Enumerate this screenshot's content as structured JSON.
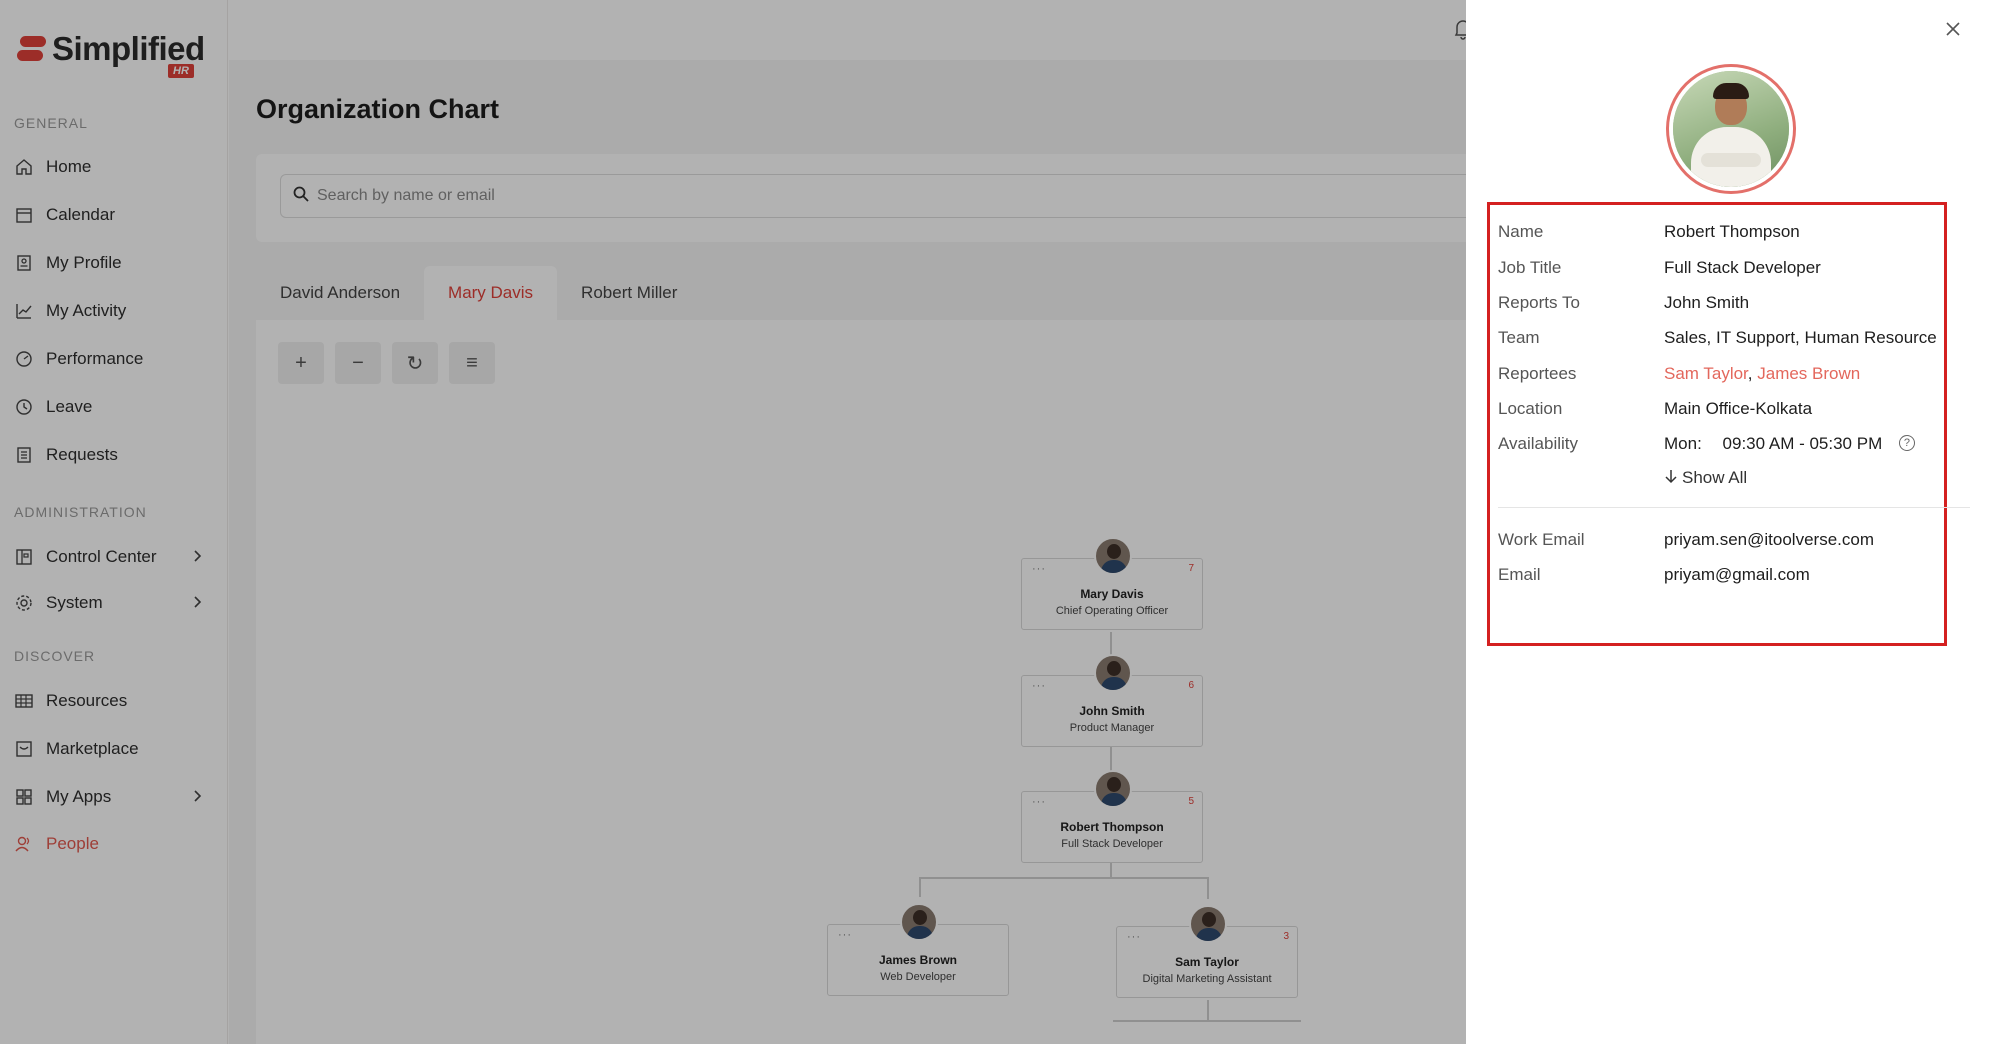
{
  "brand": {
    "name": "Simplified",
    "badge": "HR"
  },
  "sidebar": {
    "sections": [
      {
        "title": "GENERAL"
      },
      {
        "title": "ADMINISTRATION"
      },
      {
        "title": "DISCOVER"
      }
    ],
    "items": [
      {
        "label": "Home",
        "icon": "home-icon"
      },
      {
        "label": "Calendar",
        "icon": "calendar-icon"
      },
      {
        "label": "My Profile",
        "icon": "profile-icon"
      },
      {
        "label": "My Activity",
        "icon": "activity-icon"
      },
      {
        "label": "Performance",
        "icon": "performance-icon"
      },
      {
        "label": "Leave",
        "icon": "clock-icon"
      },
      {
        "label": "Requests",
        "icon": "requests-icon"
      },
      {
        "label": "Control Center",
        "icon": "control-center-icon"
      },
      {
        "label": "System",
        "icon": "gear-icon"
      },
      {
        "label": "Resources",
        "icon": "grid-table-icon"
      },
      {
        "label": "Marketplace",
        "icon": "marketplace-icon"
      },
      {
        "label": "My Apps",
        "icon": "apps-icon"
      },
      {
        "label": "People",
        "icon": "people-icon"
      }
    ],
    "active": "People",
    "accent": "#e35a4f"
  },
  "main": {
    "title": "Organization Chart",
    "search": {
      "placeholder": "Search by name or email",
      "value": ""
    },
    "tabs": [
      {
        "label": "David Anderson"
      },
      {
        "label": "Mary Davis"
      },
      {
        "label": "Robert Miller"
      }
    ],
    "active_tab": "Mary Davis",
    "tools": [
      "+",
      "−",
      "↻",
      "≡"
    ]
  },
  "org_chart": {
    "nodes": [
      {
        "name": "Mary Davis",
        "role": "Chief Operating Officer",
        "count": "7"
      },
      {
        "name": "John Smith",
        "role": "Product Manager",
        "count": "6"
      },
      {
        "name": "Robert Thompson",
        "role": "Full Stack Developer",
        "count": "5"
      },
      {
        "name": "James Brown",
        "role": "Web Developer",
        "count": ""
      },
      {
        "name": "Sam Taylor",
        "role": "Digital Marketing Assistant",
        "count": "3"
      }
    ],
    "dots": "···"
  },
  "drawer": {
    "fields": {
      "name": {
        "label": "Name",
        "value": "Robert Thompson"
      },
      "job_title": {
        "label": "Job Title",
        "value": "Full Stack Developer"
      },
      "reports_to": {
        "label": "Reports To",
        "value": "John Smith"
      },
      "team": {
        "label": "Team",
        "value": "Sales, IT Support, Human Resource"
      },
      "reportees": {
        "label": "Reportees",
        "values": [
          "Sam Taylor",
          "James Brown"
        ],
        "separator": ", "
      },
      "location": {
        "label": "Location",
        "value": "Main Office-Kolkata"
      },
      "availability": {
        "label": "Availability",
        "day": "Mon:",
        "hours": "09:30 AM - 05:30 PM",
        "show_all": "Show All"
      },
      "work_email": {
        "label": "Work Email",
        "value": "priyam.sen@itoolverse.com"
      },
      "email": {
        "label": "Email",
        "value": "priyam@gmail.com"
      }
    },
    "highlight_color": "#d42020"
  }
}
